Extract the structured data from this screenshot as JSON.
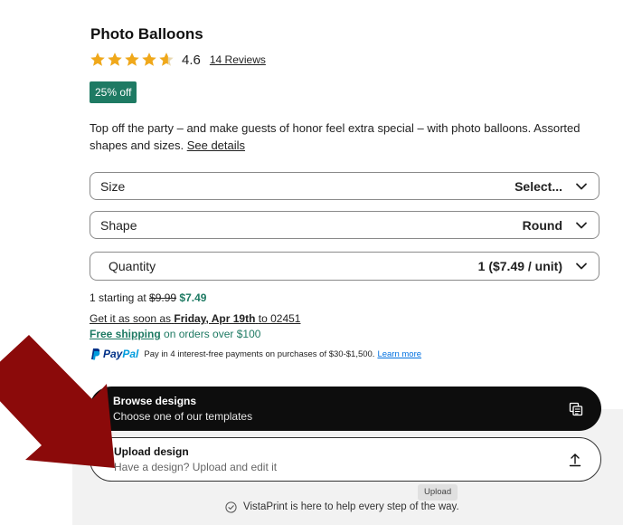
{
  "product": {
    "title": "Photo Balloons",
    "rating": "4.6",
    "rating_stars": 4.6,
    "reviews_label": "14 Reviews",
    "badge": "25% off",
    "description": "Top off the party – and make guests of honor feel extra special – with photo balloons. Assorted shapes and sizes.",
    "details_link": "See details"
  },
  "options": {
    "size": {
      "label": "Size",
      "value": "Select..."
    },
    "shape": {
      "label": "Shape",
      "value": "Round"
    },
    "quantity": {
      "label": "Quantity",
      "value": "1 ($7.49 / unit)"
    }
  },
  "pricing": {
    "starting_prefix": "1 starting at",
    "old_price": "$9.99",
    "new_price": "$7.49"
  },
  "delivery": {
    "prefix": "Get it as soon as",
    "date": "Friday, Apr 19th",
    "suffix": "to 02451"
  },
  "shipping": {
    "free_label": "Free shipping",
    "rest": "on orders over $100"
  },
  "paypal": {
    "word_pay": "Pay",
    "word_pal": "Pal",
    "text": "Pay in 4 interest-free payments on purchases of $30-$1,500.",
    "learn_more": "Learn more"
  },
  "browse_design": {
    "title": "Browse designs",
    "subtitle": "Choose one of our templates",
    "icon": "copy-icon"
  },
  "upload_design": {
    "title": "Upload design",
    "subtitle": "Have a design? Upload and edit it",
    "icon": "upload-icon",
    "tooltip": "Upload"
  },
  "help": {
    "text": "VistaPrint is here to help every step of the way."
  },
  "colors": {
    "accent_green": "#1e7a63",
    "star_gold": "#f0a81a",
    "annotation_arrow": "#8b0a0a",
    "paypal_dark": "#003087",
    "paypal_light": "#009cde"
  }
}
